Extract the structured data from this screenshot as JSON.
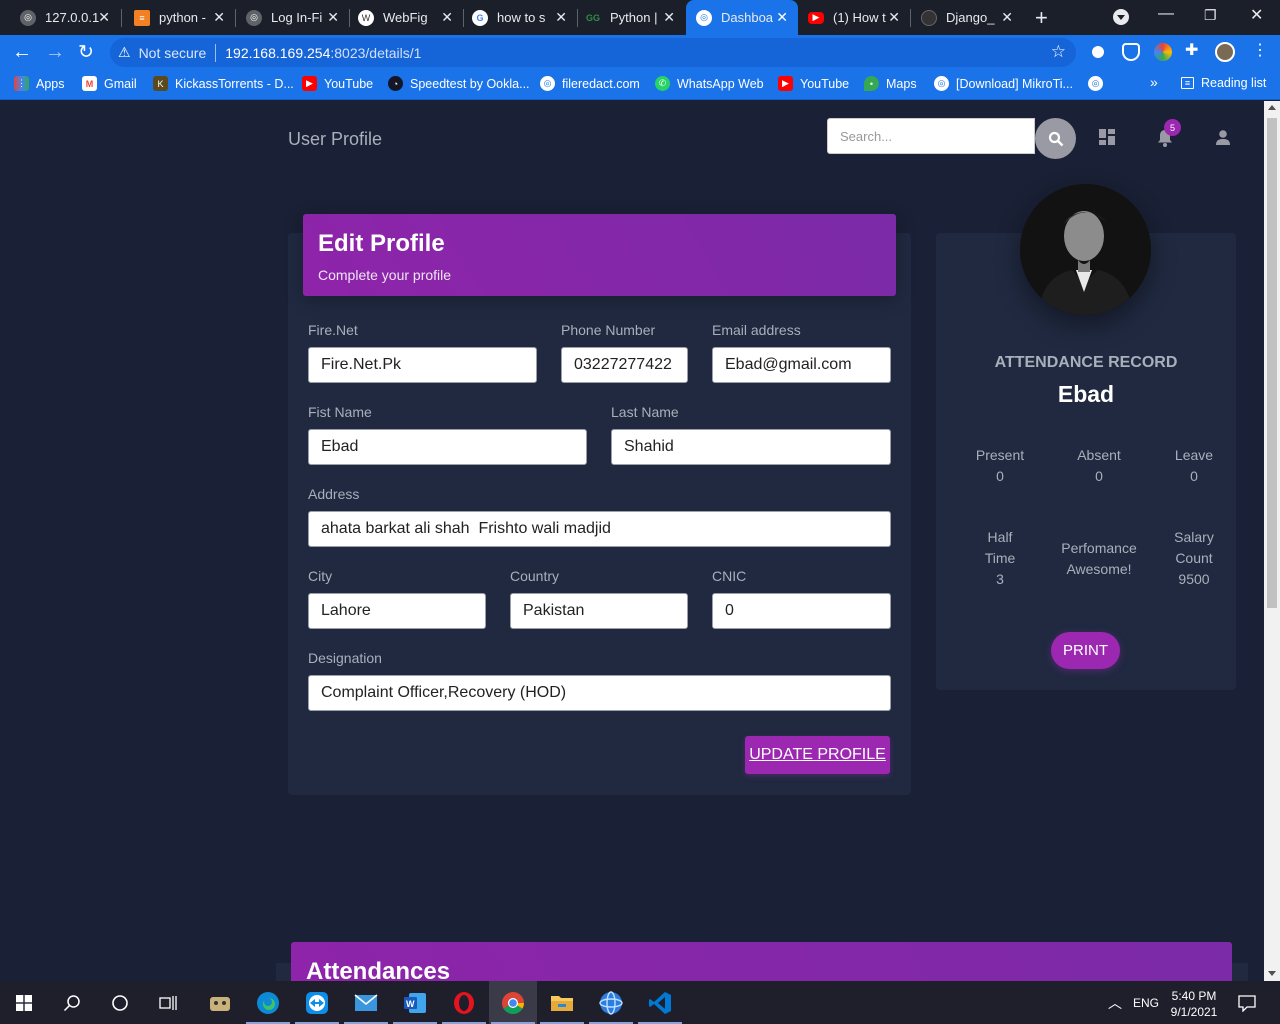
{
  "browser": {
    "tabs": [
      {
        "title": "127.0.0.1",
        "icon": "globe-icon",
        "color": "#5f6368"
      },
      {
        "title": "python -",
        "icon": "stackoverflow-icon",
        "color": "#f48024"
      },
      {
        "title": "Log In-Fi",
        "icon": "globe-icon",
        "color": "#5f6368"
      },
      {
        "title": "WebFig",
        "icon": "mikrotik-icon",
        "color": "#ffffff"
      },
      {
        "title": "how to s",
        "icon": "google-icon",
        "color": "#ffffff"
      },
      {
        "title": "Python |",
        "icon": "geeksforgeeks-icon",
        "color": "#2f8d46"
      },
      {
        "title": "Dashboa",
        "icon": "globe-icon",
        "color": "#ffffff"
      },
      {
        "title": "(1) How t",
        "icon": "youtube-icon",
        "color": "#ff0000"
      },
      {
        "title": "Django_",
        "icon": "github-icon",
        "color": "#333333"
      }
    ],
    "active_tab": 6,
    "address": {
      "security_label": "Not secure",
      "host": "192.168.169.254",
      "rest": ":8023/details/1"
    },
    "bookmarks": [
      {
        "label": "Apps",
        "icon": "apps-grid-icon",
        "color": "#ea4335"
      },
      {
        "label": "Gmail",
        "icon": "gmail-icon",
        "color": "#ea4335"
      },
      {
        "label": "KickassTorrents - D...",
        "icon": "kickass-icon",
        "color": "#5a4a1e"
      },
      {
        "label": "YouTube",
        "icon": "youtube-icon",
        "color": "#ff0000"
      },
      {
        "label": "Speedtest by Ookla...",
        "icon": "speedtest-icon",
        "color": "#141526"
      },
      {
        "label": "fileredact.com",
        "icon": "globe-icon",
        "color": "#1a73e8"
      },
      {
        "label": "WhatsApp Web",
        "icon": "whatsapp-icon",
        "color": "#25d366"
      },
      {
        "label": "YouTube",
        "icon": "youtube-icon",
        "color": "#ff0000"
      },
      {
        "label": "Maps",
        "icon": "maps-icon",
        "color": "#34a853"
      },
      {
        "label": "[Download] MikroTi...",
        "icon": "globe-icon",
        "color": "#1a73e8"
      }
    ],
    "overflow_label": "»",
    "reading_list_label": "Reading list"
  },
  "navbar": {
    "brand": "User Profile",
    "search_placeholder": "Search...",
    "notification_count": "5"
  },
  "edit_profile": {
    "title": "Edit Profile",
    "subtitle": "Complete your profile",
    "fields": {
      "company": {
        "label": "Fire.Net",
        "value": "Fire.Net.Pk"
      },
      "phone": {
        "label": "Phone Number",
        "value": "03227277422"
      },
      "email": {
        "label": "Email address",
        "value": "Ebad@gmail.com"
      },
      "first_name": {
        "label": "Fist Name",
        "value": "Ebad"
      },
      "last_name": {
        "label": "Last Name",
        "value": "Shahid"
      },
      "address": {
        "label": "Address",
        "value": "ahata barkat ali shah  Frishto wali madjid"
      },
      "city": {
        "label": "City",
        "value": "Lahore"
      },
      "country": {
        "label": "Country",
        "value": "Pakistan"
      },
      "cnic": {
        "label": "CNIC",
        "value": "0"
      },
      "designation": {
        "label": "Designation",
        "value": "Complaint Officer,Recovery (HOD)"
      }
    },
    "update_button": "UPDATE PROFILE"
  },
  "profile_card": {
    "section_title": "ATTENDANCE RECORD",
    "name": "Ebad",
    "stats": {
      "present": {
        "label": "Present",
        "value": "0"
      },
      "absent": {
        "label": "Absent",
        "value": "0"
      },
      "leave": {
        "label": "Leave",
        "value": "0"
      },
      "half_time": {
        "label_1": "Half",
        "label_2": "Time",
        "value": "3"
      },
      "performance": {
        "label": "Perfomance",
        "value": "Awesome!"
      },
      "salary": {
        "label_1": "Salary",
        "label_2": "Count",
        "value": "9500"
      }
    },
    "print_button": "PRINT"
  },
  "attendances": {
    "title": "Attendances"
  },
  "taskbar": {
    "language": "ENG",
    "time": "5:40 PM",
    "date": "9/1/2021"
  },
  "colors": {
    "page_bg": "#1a2035",
    "card_bg": "#202940",
    "accent_purple": "#9c27b0",
    "browser_blue": "#1a73e8"
  }
}
